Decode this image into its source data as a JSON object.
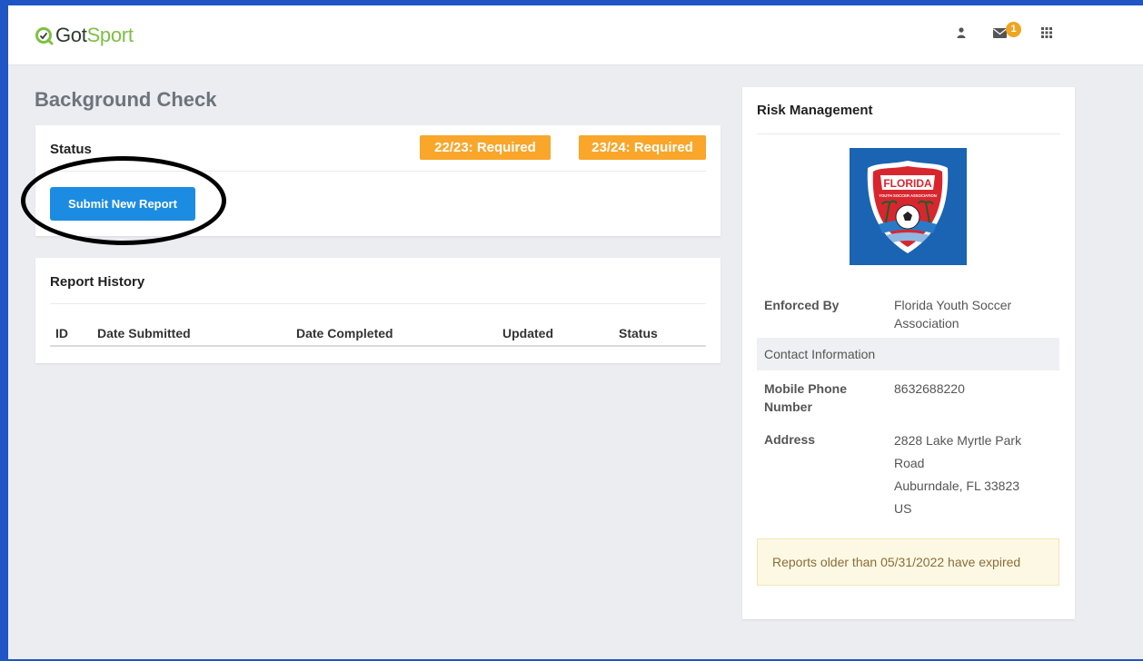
{
  "app": {
    "brand_part1": "Got",
    "brand_part2": "Sport",
    "notification_count": "1",
    "colors": {
      "brand_green": "#7ec043",
      "primary_blue": "#1c8ce3",
      "warning_orange": "#f9a62b",
      "frame_blue": "#1f55c4"
    }
  },
  "topbar": {
    "icons": [
      "user-icon",
      "mail-icon",
      "apps-grid-icon"
    ]
  },
  "page": {
    "title": "Background Check"
  },
  "status_card": {
    "title": "Status",
    "badges": [
      "22/23: Required",
      "23/24: Required"
    ],
    "submit_label": "Submit New Report"
  },
  "history_card": {
    "title": "Report History",
    "columns": [
      "ID",
      "Date Submitted",
      "Date Completed",
      "Updated",
      "Status"
    ],
    "rows": []
  },
  "risk_card": {
    "title": "Risk Management",
    "logo_text": {
      "line1": "FLORIDA",
      "line2": "YOUTH SOCCER ASSOCIATION"
    },
    "enforced_by_label": "Enforced By",
    "enforced_by_value": "Florida Youth Soccer Association",
    "contact_header": "Contact Information",
    "phone_label": "Mobile Phone Number",
    "phone_value": "8632688220",
    "address_label": "Address",
    "address_lines": [
      "2828 Lake Myrtle Park",
      "Road",
      "Auburndale, FL 33823",
      "US"
    ],
    "alert": "Reports older than 05/31/2022 have expired"
  }
}
